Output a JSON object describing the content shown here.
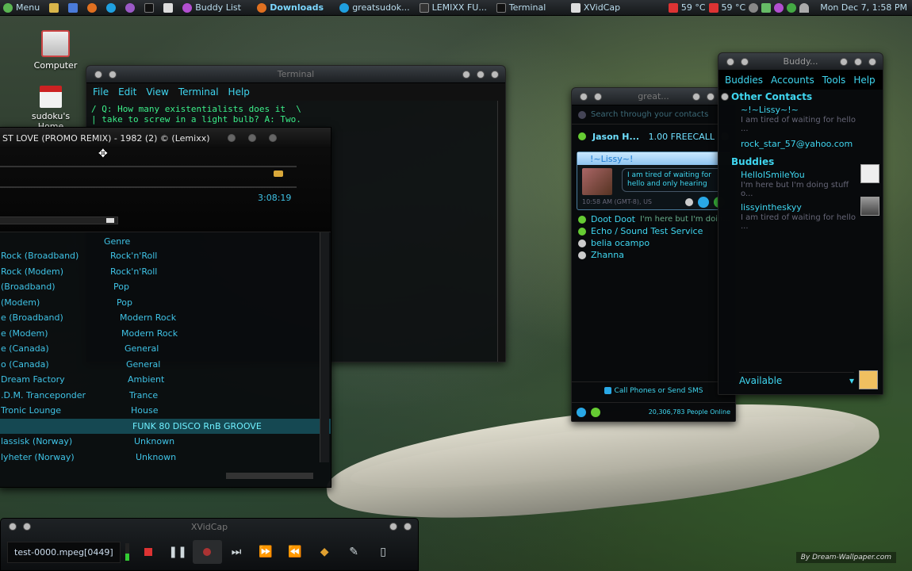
{
  "panel": {
    "menu_label": "Menu",
    "tasks": [
      {
        "label": "Buddy List"
      },
      {
        "label": "Downloads"
      },
      {
        "label": "greatsudok..."
      },
      {
        "label": "LEMIXX FU..."
      },
      {
        "label": "Terminal"
      },
      {
        "label": "XVidCap"
      }
    ],
    "temp1": "59 °C",
    "temp2": "59 °C",
    "clock": "Mon Dec  7,  1:58 PM"
  },
  "desktop": {
    "computer_label": "Computer",
    "home_label": "sudoku's Home"
  },
  "terminal": {
    "title": "Terminal",
    "menu": [
      "File",
      "Edit",
      "View",
      "Terminal",
      "Help"
    ],
    "lines": [
      "/ Q: How many existentialists does it  \\",
      "| take to screw in a light bulb? A: Two."
    ]
  },
  "music": {
    "now_playing": "ST LOVE (PROMO REMIX) - 1982 (2) © (Lemixx)",
    "time": "3:08:19",
    "genre_header": "Genre",
    "rows": [
      {
        "station": "Rock (Broadband)",
        "genre": "Rock'n'Roll"
      },
      {
        "station": "Rock (Modem)",
        "genre": "Rock'n'Roll"
      },
      {
        "station": "(Broadband)",
        "genre": "Pop"
      },
      {
        "station": "(Modem)",
        "genre": "Pop"
      },
      {
        "station": "e (Broadband)",
        "genre": "Modern Rock"
      },
      {
        "station": "e (Modem)",
        "genre": "Modern Rock"
      },
      {
        "station": "e (Canada)",
        "genre": "General"
      },
      {
        "station": "o (Canada)",
        "genre": "General"
      },
      {
        "station": "Dream Factory",
        "genre": "Ambient"
      },
      {
        "station": ".D.M. Tranceponder",
        "genre": "Trance"
      },
      {
        "station": "Tronic Lounge",
        "genre": "House"
      },
      {
        "station": "",
        "genre": "FUNK 80 DISCO RnB GROOVE"
      },
      {
        "station": "lassisk (Norway)",
        "genre": "Unknown"
      },
      {
        "station": "lyheter (Norway)",
        "genre": "Unknown"
      }
    ]
  },
  "messenger": {
    "title": "great...",
    "search_placeholder": "Search through your contacts",
    "me_name": "Jason H...",
    "credit": "1.00 FREECALL",
    "card": {
      "name": "!~Lissy~!",
      "message": "I am tired of waiting for hello and only hearing",
      "meta": "10:58 AM (GMT-8), US"
    },
    "contacts": [
      {
        "name": "Doot Doot",
        "status": "I'm here but I'm doin..."
      },
      {
        "name": "Echo / Sound Test Service",
        "status": ""
      },
      {
        "name": "belia ocampo",
        "status": ""
      },
      {
        "name": "Zhanna",
        "status": ""
      }
    ],
    "call_label": "Call Phones or Send SMS",
    "online": "20,306,783 People Online"
  },
  "buddy": {
    "title": "Buddy...",
    "menu": [
      "Buddies",
      "Accounts",
      "Tools",
      "Help"
    ],
    "group1": "Other Contacts",
    "g1_items": [
      {
        "name": "~!~Lissy~!~",
        "status": "I am tired of waiting for hello ..."
      },
      {
        "name": "rock_star_57@yahoo.com",
        "status": ""
      }
    ],
    "group2": "Buddies",
    "g2_items": [
      {
        "name": "HelloISmileYou",
        "status": "I'm here but I'm doing stuff o..."
      },
      {
        "name": "lissyintheskyy",
        "status": "I am tired of waiting for hello ..."
      }
    ],
    "status_select": "Available"
  },
  "xvidcap": {
    "title": "XVidCap",
    "filename": "test-0000.mpeg[0449]"
  },
  "watermark": "By Dream-Wallpaper.com",
  "colors": {
    "accent": "#3fd6f0",
    "terminal_green": "#3cf08a",
    "selection": "#154852"
  }
}
